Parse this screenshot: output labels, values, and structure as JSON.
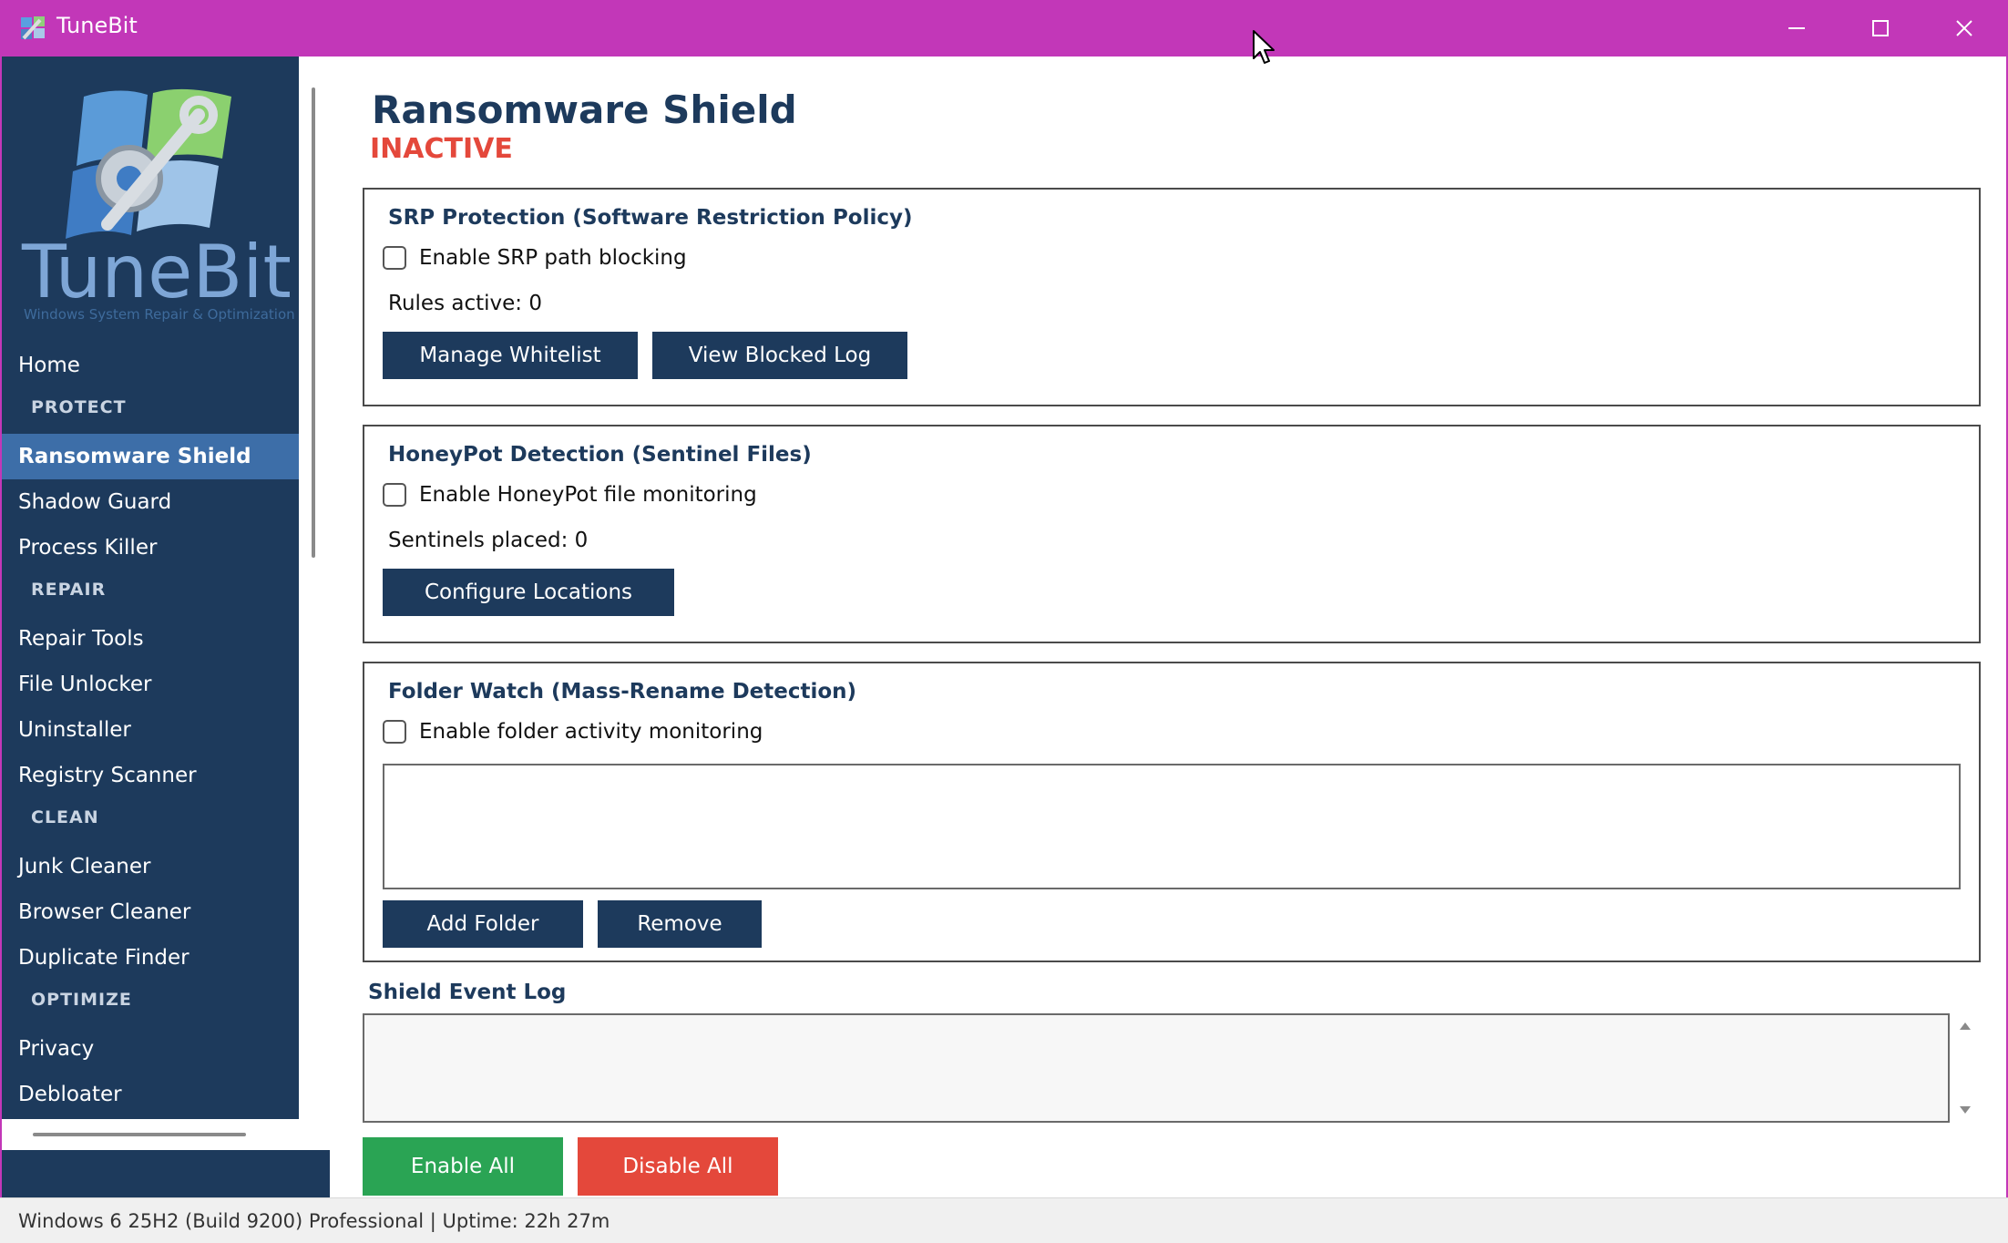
{
  "window": {
    "title": "TuneBit",
    "accent_color": "#c237b8",
    "controls": [
      "minimize-icon",
      "maximize-icon",
      "close-icon"
    ]
  },
  "sidebar": {
    "logo_text": "TuneBit",
    "logo_tagline": "Windows System Repair & Optimization",
    "items": [
      {
        "label": "Home",
        "type": "item"
      },
      {
        "label": "PROTECT",
        "type": "section"
      },
      {
        "label": "Ransomware Shield",
        "type": "item",
        "active": true
      },
      {
        "label": "Shadow Guard",
        "type": "item"
      },
      {
        "label": "Process Killer",
        "type": "item"
      },
      {
        "label": "REPAIR",
        "type": "section"
      },
      {
        "label": "Repair Tools",
        "type": "item"
      },
      {
        "label": "File Unlocker",
        "type": "item"
      },
      {
        "label": "Uninstaller",
        "type": "item"
      },
      {
        "label": "Registry Scanner",
        "type": "item"
      },
      {
        "label": "CLEAN",
        "type": "section"
      },
      {
        "label": "Junk Cleaner",
        "type": "item"
      },
      {
        "label": "Browser Cleaner",
        "type": "item"
      },
      {
        "label": "Duplicate Finder",
        "type": "item"
      },
      {
        "label": "OPTIMIZE",
        "type": "section"
      },
      {
        "label": "Privacy",
        "type": "item"
      },
      {
        "label": "Debloater",
        "type": "item"
      }
    ]
  },
  "main": {
    "title": "Ransomware Shield",
    "status": "INACTIVE",
    "status_color": "#e4483b",
    "srp": {
      "title": "SRP Protection (Software Restriction Policy)",
      "checkbox_label": "Enable SRP path blocking",
      "checked": false,
      "info": "Rules active: 0",
      "buttons": [
        "Manage Whitelist",
        "View Blocked Log"
      ]
    },
    "honeypot": {
      "title": "HoneyPot Detection (Sentinel Files)",
      "checkbox_label": "Enable HoneyPot file monitoring",
      "checked": false,
      "info": "Sentinels placed: 0",
      "buttons": [
        "Configure Locations"
      ]
    },
    "folder_watch": {
      "title": "Folder Watch (Mass-Rename Detection)",
      "checkbox_label": "Enable folder activity monitoring",
      "checked": false,
      "buttons": [
        "Add Folder",
        "Remove"
      ]
    },
    "event_log": {
      "title": "Shield Event Log"
    },
    "enable_all": "Enable All",
    "disable_all": "Disable All",
    "enable_color": "#2aa454",
    "disable_color": "#e4483b"
  },
  "statusbar": {
    "text": "Windows 6 25H2 (Build 9200) Professional  |  Uptime: 22h 27m"
  }
}
